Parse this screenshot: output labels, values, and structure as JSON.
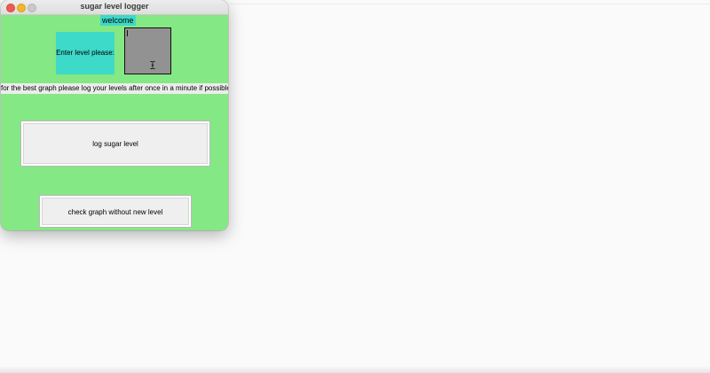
{
  "window": {
    "title": "sugar level logger"
  },
  "content": {
    "welcome_label": "welcome",
    "prompt_label": "Enter level please:",
    "level_input_value": "",
    "hint_text": "for the best graph please log your levels after once in a minute if possible."
  },
  "buttons": {
    "log_label": "log sugar level",
    "check_graph_label": "check graph without new level"
  },
  "colors": {
    "window_background": "#84e884",
    "label_background": "#3dd9c9",
    "input_background": "#9a9a9a",
    "close_button": "#ee5a52",
    "minimize_button": "#f2b62b"
  },
  "icons": {
    "cursor": "ibeam-cursor-icon"
  }
}
